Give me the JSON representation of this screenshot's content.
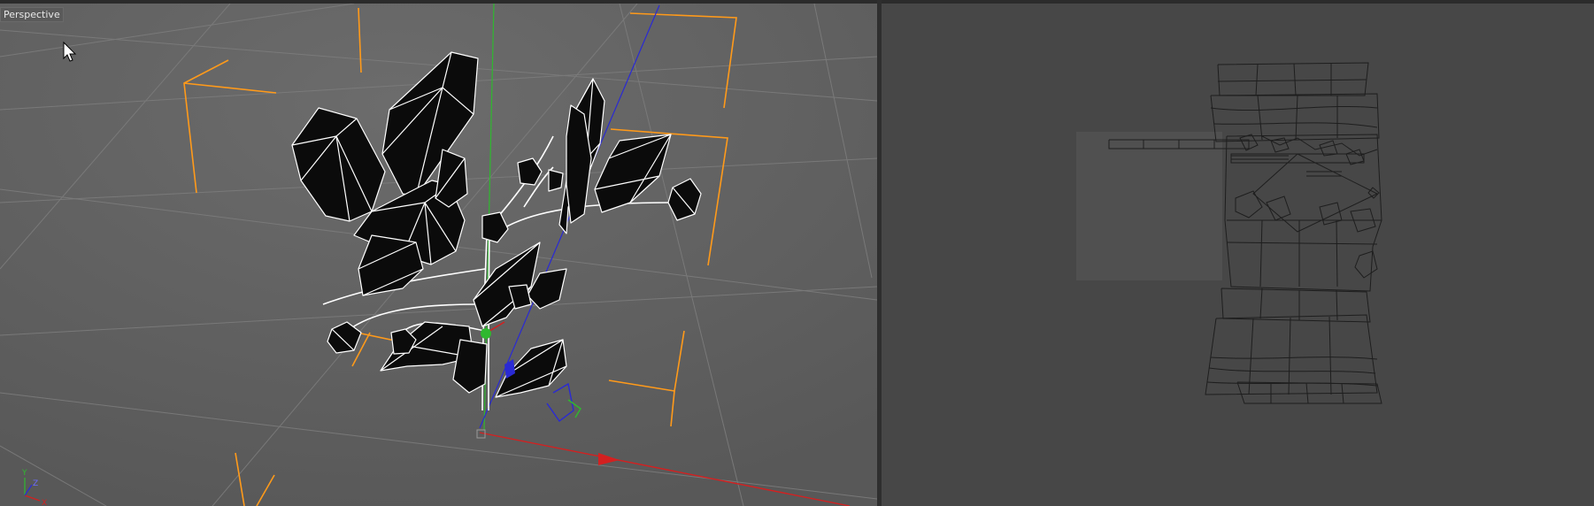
{
  "viewport": {
    "label": "Perspective",
    "axis_labels": {
      "y": "Y",
      "z": "Z",
      "x": "X"
    }
  },
  "icons": [
    "mouse-cursor-icon",
    "axis-gizmo-icon"
  ],
  "colors": {
    "viewport_bg": "#6a6a6a",
    "uv_bg": "#474747",
    "axis_x": "#d42020",
    "axis_y": "#2fb82f",
    "axis_z": "#2a2ad4",
    "bbox": "#ff9a1a",
    "wire": "#ffffff"
  }
}
